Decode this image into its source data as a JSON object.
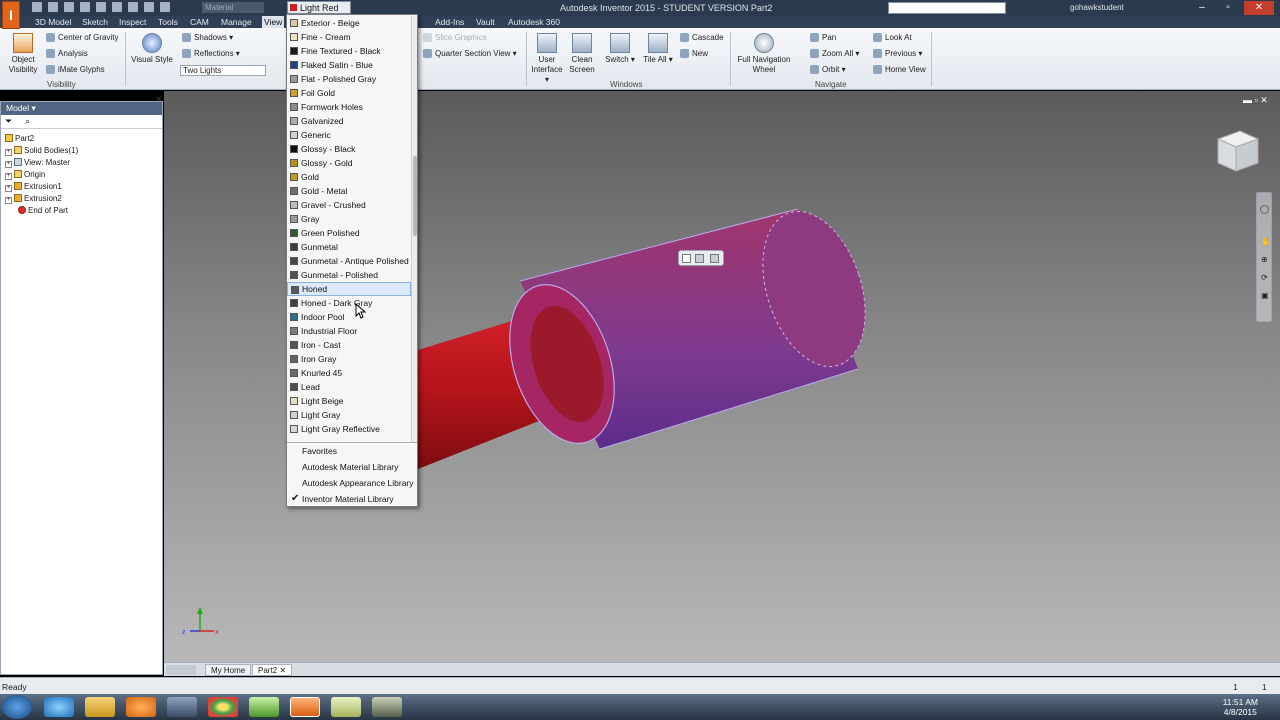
{
  "titlebar": {
    "logo": "I",
    "material_value": "Material",
    "appearance_value": "Light Red",
    "window_title": "Autodesk Inventor 2015 - STUDENT VERSION   Part2",
    "user": "gohawkstudent"
  },
  "tabs": [
    "3D Model",
    "Sketch",
    "Inspect",
    "Tools",
    "CAM",
    "Manage",
    "View",
    "Add-Ins",
    "Vault",
    "Autodesk 360"
  ],
  "ribbon": {
    "object_visibility": "Object Visibility",
    "center_of_gravity": "Center of Gravity",
    "analysis": "Analysis",
    "imate_glyphs": "iMate Glyphs",
    "visibility_panel": "Visibility",
    "visual_style": "Visual Style",
    "shadows": "Shadows",
    "reflections": "Reflections",
    "lighting": "Two Lights",
    "slice_graphics": "Slice Graphics",
    "quarter_section_view": "Quarter Section View",
    "user_interface": "User Interface",
    "clean_screen": "Clean Screen",
    "switch": "Switch",
    "tile_all": "Tile All",
    "cascade": "Cascade",
    "new": "New",
    "windows_panel": "Windows",
    "full_navigation_wheel": "Full Navigation Wheel",
    "pan": "Pan",
    "zoom_all": "Zoom All",
    "orbit": "Orbit",
    "look_at": "Look At",
    "previous": "Previous",
    "home_view": "Home View",
    "navigate_panel": "Navigate"
  },
  "browser": {
    "title": "Model",
    "items": [
      {
        "label": "Part2",
        "icon": "part-icon"
      },
      {
        "label": "Solid Bodies(1)",
        "icon": "folder-icon"
      },
      {
        "label": "View: Master",
        "icon": "view-icon"
      },
      {
        "label": "Origin",
        "icon": "folder-icon"
      },
      {
        "label": "Extrusion1",
        "icon": "extrusion-icon"
      },
      {
        "label": "Extrusion2",
        "icon": "extrusion-icon"
      },
      {
        "label": "End of Part",
        "icon": "end-of-part-icon"
      }
    ]
  },
  "dropdown": {
    "items": [
      {
        "label": "Exterior - Beige",
        "color": "#d8c9a4"
      },
      {
        "label": "Fine - Cream",
        "color": "#efe3c0"
      },
      {
        "label": "Fine Textured - Black",
        "color": "#1b1b1b"
      },
      {
        "label": "Flaked Satin - Blue",
        "color": "#1d3e8a"
      },
      {
        "label": "Flat - Polished Gray",
        "color": "#9a9a9a"
      },
      {
        "label": "Foil Gold",
        "color": "#c9a227"
      },
      {
        "label": "Formwork Holes",
        "color": "#8a8a8a"
      },
      {
        "label": "Galvanized",
        "color": "#a7adb2"
      },
      {
        "label": "Generic",
        "color": "#cfcfcf"
      },
      {
        "label": "Glossy - Black",
        "color": "#0c0c0c"
      },
      {
        "label": "Glossy - Gold",
        "color": "#b8911c"
      },
      {
        "label": "Gold",
        "color": "#c49a20"
      },
      {
        "label": "Gold - Metal",
        "color": "#6e6e6e"
      },
      {
        "label": "Gravel - Crushed",
        "color": "#bdbdbd"
      },
      {
        "label": "Gray",
        "color": "#9b9b9b"
      },
      {
        "label": "Green Polished",
        "color": "#2f5a33"
      },
      {
        "label": "Gunmetal",
        "color": "#3a3d40"
      },
      {
        "label": "Gunmetal - Antique Polished",
        "color": "#45484b"
      },
      {
        "label": "Gunmetal - Polished",
        "color": "#505357"
      },
      {
        "label": "Honed",
        "color": "#5a5a5a"
      },
      {
        "label": "Honed - Dark Gray",
        "color": "#3f3f3f"
      },
      {
        "label": "Indoor Pool",
        "color": "#2e6f8e"
      },
      {
        "label": "Industrial Floor",
        "color": "#7a7a7a"
      },
      {
        "label": "Iron - Cast",
        "color": "#555555"
      },
      {
        "label": "Iron Gray",
        "color": "#606468"
      },
      {
        "label": "Knurled 45",
        "color": "#6a6a6a"
      },
      {
        "label": "Lead",
        "color": "#4c4f52"
      },
      {
        "label": "Light Beige",
        "color": "#e6dcc2"
      },
      {
        "label": "Light Gray",
        "color": "#cfcfcf"
      },
      {
        "label": "Light Gray Reflective",
        "color": "#d8d8d8"
      }
    ],
    "highlighted": "Honed",
    "libraries": [
      "Favorites",
      "Autodesk Material Library",
      "Autodesk Appearance Library",
      "Inventor Material Library"
    ],
    "checked_library": "Inventor Material Library"
  },
  "doc_tabs": {
    "home": "My Home",
    "part": "Part2"
  },
  "status": {
    "text": "Ready",
    "num1": "1",
    "num2": "1"
  },
  "taskbar": {
    "time": "11:51 AM",
    "date": "4/8/2015"
  },
  "colors": {
    "accent": "#2b3a4e",
    "selected_part": "#8a2f86",
    "red_part": "#b3141a"
  }
}
